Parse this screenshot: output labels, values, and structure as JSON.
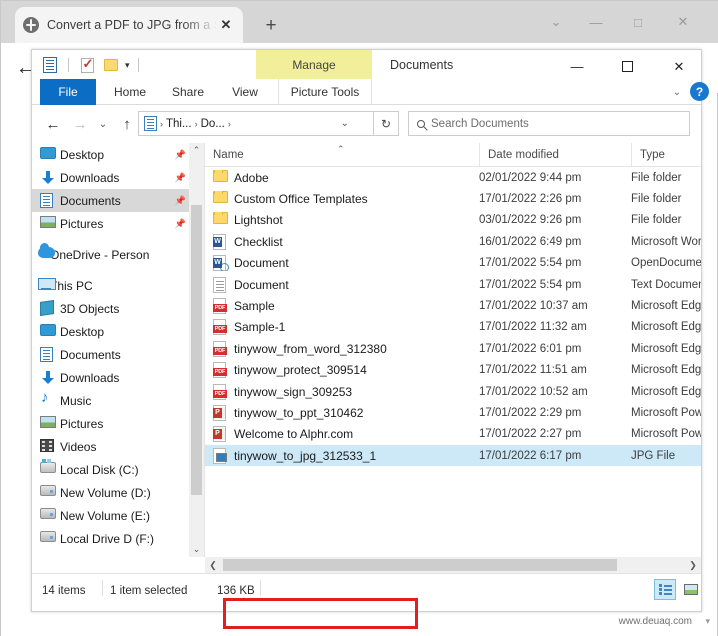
{
  "browser": {
    "tab": {
      "title": "Convert a PDF to JPG from a Sma",
      "favicon": "globe-icon",
      "close_label": "✕"
    },
    "new_tab_label": "+",
    "window_controls": {
      "chevron": "⌄",
      "minimize": "—",
      "maximize": "□",
      "close": "✕"
    },
    "back_label": "←"
  },
  "explorer": {
    "title": "Documents",
    "contextual_tab": "Manage",
    "quick_access": {
      "properties_icon": "document-properties-icon",
      "checklist_icon": "checkmark-document-icon",
      "new_folder_icon": "new-folder-icon",
      "dropdown_caret": "▾"
    },
    "window_controls": {
      "minimize": "—",
      "maximize": "□",
      "close": "✕"
    },
    "ribbon": {
      "tabs": [
        {
          "label": "File"
        },
        {
          "label": "Home"
        },
        {
          "label": "Share"
        },
        {
          "label": "View"
        },
        {
          "label": "Picture Tools"
        }
      ],
      "expand_caret": "⌄",
      "help_label": "?"
    },
    "address": {
      "back": "←",
      "forward": "→",
      "history_caret": "⌄",
      "up": "↑",
      "breadcrumbs": [
        "Thi...",
        "Do..."
      ],
      "separator": "›",
      "dropdown_caret": "⌄",
      "refresh": "↻"
    },
    "search": {
      "placeholder": "Search Documents",
      "value": ""
    },
    "navigation": {
      "items": [
        {
          "label": "Desktop",
          "icon": "desktop-icon",
          "pinned": true,
          "indent": 1,
          "selected": false
        },
        {
          "label": "Downloads",
          "icon": "download-icon",
          "pinned": true,
          "indent": 1,
          "selected": false
        },
        {
          "label": "Documents",
          "icon": "documents-icon",
          "pinned": true,
          "indent": 1,
          "selected": true
        },
        {
          "label": "Pictures",
          "icon": "pictures-icon",
          "pinned": true,
          "indent": 1,
          "selected": false
        },
        {
          "label": "OneDrive - Person",
          "icon": "onedrive-icon",
          "pinned": false,
          "indent": 0,
          "selected": false
        },
        {
          "label": "This PC",
          "icon": "this-pc-icon",
          "pinned": false,
          "indent": 0,
          "selected": false
        },
        {
          "label": "3D Objects",
          "icon": "3d-objects-icon",
          "pinned": false,
          "indent": 1,
          "selected": false
        },
        {
          "label": "Desktop",
          "icon": "desktop-icon",
          "pinned": false,
          "indent": 1,
          "selected": false
        },
        {
          "label": "Documents",
          "icon": "documents-icon",
          "pinned": false,
          "indent": 1,
          "selected": false
        },
        {
          "label": "Downloads",
          "icon": "download-icon",
          "pinned": false,
          "indent": 1,
          "selected": false
        },
        {
          "label": "Music",
          "icon": "music-icon",
          "pinned": false,
          "indent": 1,
          "selected": false
        },
        {
          "label": "Pictures",
          "icon": "pictures-icon",
          "pinned": false,
          "indent": 1,
          "selected": false
        },
        {
          "label": "Videos",
          "icon": "videos-icon",
          "pinned": false,
          "indent": 1,
          "selected": false
        },
        {
          "label": "Local Disk (C:)",
          "icon": "system-disk-icon",
          "pinned": false,
          "indent": 1,
          "selected": false
        },
        {
          "label": "New Volume (D:)",
          "icon": "disk-icon",
          "pinned": false,
          "indent": 1,
          "selected": false
        },
        {
          "label": "New Volume (E:)",
          "icon": "disk-icon",
          "pinned": false,
          "indent": 1,
          "selected": false
        },
        {
          "label": "Local Drive D (F:)",
          "icon": "disk-icon",
          "pinned": false,
          "indent": 1,
          "selected": false
        }
      ]
    },
    "columns": [
      {
        "key": "name",
        "label": "Name",
        "sorted": true,
        "sort_caret": "⌃"
      },
      {
        "key": "date",
        "label": "Date modified"
      },
      {
        "key": "type",
        "label": "Type"
      }
    ],
    "files": [
      {
        "name": "Adobe",
        "date": "02/01/2022 9:44 pm",
        "type": "File folder",
        "icon": "folder-icon",
        "selected": false
      },
      {
        "name": "Custom Office Templates",
        "date": "17/01/2022 2:26 pm",
        "type": "File folder",
        "icon": "folder-icon",
        "selected": false
      },
      {
        "name": "Lightshot",
        "date": "03/01/2022 9:26 pm",
        "type": "File folder",
        "icon": "folder-icon",
        "selected": false
      },
      {
        "name": "Checklist",
        "date": "16/01/2022 6:49 pm",
        "type": "Microsoft Word D",
        "icon": "word-icon",
        "selected": false
      },
      {
        "name": "Document",
        "date": "17/01/2022 5:54 pm",
        "type": "OpenDocument T",
        "icon": "odt-icon",
        "selected": false
      },
      {
        "name": "Document",
        "date": "17/01/2022 5:54 pm",
        "type": "Text Document",
        "icon": "text-icon",
        "selected": false
      },
      {
        "name": "Sample",
        "date": "17/01/2022 10:37 am",
        "type": "Microsoft Edge P",
        "icon": "pdf-icon",
        "selected": false
      },
      {
        "name": "Sample-1",
        "date": "17/01/2022 11:32 am",
        "type": "Microsoft Edge P",
        "icon": "pdf-icon",
        "selected": false
      },
      {
        "name": "tinywow_from_word_312380",
        "date": "17/01/2022 6:01 pm",
        "type": "Microsoft Edge P",
        "icon": "pdf-icon",
        "selected": false
      },
      {
        "name": "tinywow_protect_309514",
        "date": "17/01/2022 11:51 am",
        "type": "Microsoft Edge P",
        "icon": "pdf-icon",
        "selected": false
      },
      {
        "name": "tinywow_sign_309253",
        "date": "17/01/2022 10:52 am",
        "type": "Microsoft Edge P",
        "icon": "pdf-icon",
        "selected": false
      },
      {
        "name": "tinywow_to_ppt_310462",
        "date": "17/01/2022 2:29 pm",
        "type": "Microsoft PowerP",
        "icon": "ppt-icon",
        "selected": false
      },
      {
        "name": "Welcome to Alphr.com",
        "date": "17/01/2022 2:27 pm",
        "type": "Microsoft PowerP",
        "icon": "ppt-icon",
        "selected": false
      },
      {
        "name": "tinywow_to_jpg_312533_1",
        "date": "17/01/2022 6:17 pm",
        "type": "JPG File",
        "icon": "jpg-icon",
        "selected": true
      }
    ],
    "status": {
      "item_count": "14 items",
      "selection": "1 item selected",
      "size": "136 KB"
    },
    "view_buttons": {
      "details": "details-view-icon",
      "large_icons": "large-icons-view-icon"
    },
    "scrollbars": {
      "left_up": "⌃",
      "left_down": "⌄",
      "h_left": "❮",
      "h_right": "❯"
    }
  },
  "annotation": {
    "highlight_color": "#e02020",
    "target_row": "tinywow_to_jpg_312533_1"
  },
  "watermark": {
    "text": "www.deuaq.com",
    "caret": "▾"
  }
}
